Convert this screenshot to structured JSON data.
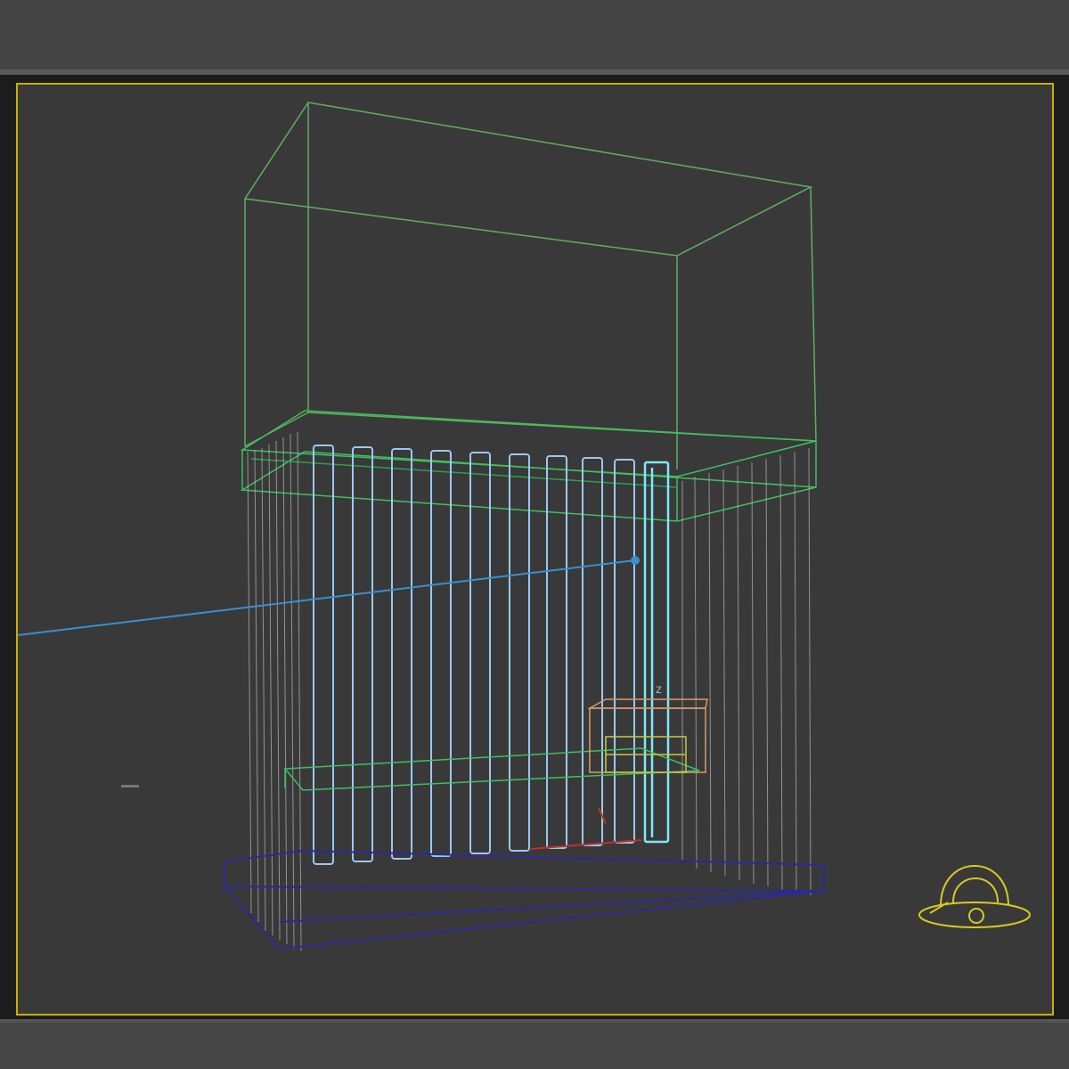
{
  "app": {
    "window_title": ""
  },
  "viewport": {
    "label": "",
    "active_border_color": "#c8b000",
    "background_color": "#393939"
  },
  "scene": {
    "objects": [
      {
        "name": "hood-top-box",
        "color": "#5fae5f"
      },
      {
        "name": "shelf-band",
        "color": "#3fbf5f"
      },
      {
        "name": "radiator-fins",
        "color": "#9cc8f0"
      },
      {
        "name": "selected-fin",
        "color": "#7fe8ff"
      },
      {
        "name": "side-panels",
        "color": "#b8b8b8"
      },
      {
        "name": "base-plinth",
        "color": "#2a2a9a"
      },
      {
        "name": "mid-rail",
        "color": "#3fbf5f"
      },
      {
        "name": "control-box",
        "color": "#d99a6a"
      },
      {
        "name": "control-box-inner",
        "color": "#c8c840"
      },
      {
        "name": "target-line",
        "color": "#3a8fd0"
      },
      {
        "name": "ground-edge",
        "color": "#c03030"
      }
    ],
    "camera_icon": "camera-helmet-icon",
    "camera_color": "#d8c820",
    "axis_label": "z"
  }
}
